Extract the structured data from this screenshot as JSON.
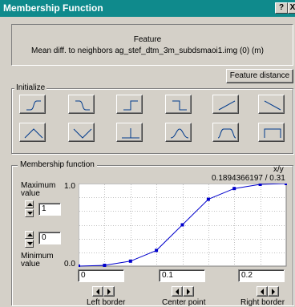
{
  "window": {
    "title": "Membership Function",
    "help_label": "?",
    "close_label": "X"
  },
  "feature": {
    "heading": "Feature",
    "name": "Mean diff. to neighbors ag_stef_dtm_3m_subdsmaoi1.img  (0) (m)",
    "distance_button_label": "Feature distance"
  },
  "initialize": {
    "label": "Initialize",
    "shapes": [
      "larger-than-smooth",
      "smaller-than-smooth",
      "larger-than",
      "smaller-than",
      "linear-increasing",
      "linear-decreasing",
      "triangle",
      "inverted-triangle",
      "singleton",
      "approximate-gaussian",
      "about-range",
      "full-range"
    ]
  },
  "membership_function": {
    "label": "Membership function",
    "max_label": "Maximum value",
    "max_value": "1",
    "min_label": "Minimum value",
    "min_value": "0",
    "axis_label": "x/y",
    "cursor_readout": "0.1894366197 / 0.31",
    "y_top_label": "1.0",
    "y_bottom_label": "0.0",
    "left_border_value": "0",
    "center_point_value": "0.1",
    "right_border_value": "0.2",
    "left_border_label": "Left border",
    "center_point_label": "Center point",
    "right_border_label": "Right border"
  },
  "chart_data": {
    "type": "line",
    "x": [
      0,
      0.025,
      0.05,
      0.075,
      0.1,
      0.125,
      0.15,
      0.175,
      0.2
    ],
    "y": [
      0.0,
      0.01,
      0.06,
      0.19,
      0.5,
      0.81,
      0.94,
      0.99,
      1.0
    ],
    "xlim": [
      0,
      0.2
    ],
    "ylim": [
      0,
      1
    ],
    "grid": true,
    "line_color": "#0000cc"
  },
  "colors": {
    "title_bar": "#0f8a8c",
    "dialog": "#d4d0c8",
    "curve": "#0000cc"
  }
}
